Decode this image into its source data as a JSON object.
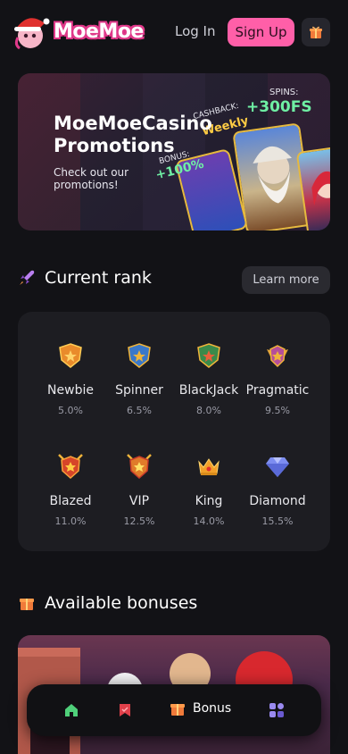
{
  "header": {
    "logo_text": "MoeMoe",
    "login_label": "Log In",
    "signup_label": "Sign Up",
    "gift_icon": "gift-icon"
  },
  "promo": {
    "title": "MoeMoeCasino Promotions",
    "subtitle": "Check out our promotions!",
    "spins_label": "SPINS:",
    "spins_value": "+300FS",
    "cashback_label": "CASHBACK:",
    "cashback_value": "Weekly",
    "bonus_label": "BONUS:",
    "bonus_value": "+100%"
  },
  "rank": {
    "title": "Current rank",
    "learn_more": "Learn more",
    "items": [
      {
        "name": "Newbie",
        "pct": "5.0%",
        "color": "#e98b2b"
      },
      {
        "name": "Spinner",
        "pct": "6.5%",
        "color": "#3a78c9"
      },
      {
        "name": "BlackJack",
        "pct": "8.0%",
        "color": "#3a8a4a"
      },
      {
        "name": "Pragmatic",
        "pct": "9.5%",
        "color": "#b54e9a"
      },
      {
        "name": "Blazed",
        "pct": "11.0%",
        "color": "#d64529"
      },
      {
        "name": "VIP",
        "pct": "12.5%",
        "color": "#e07b2a"
      },
      {
        "name": "King",
        "pct": "14.0%",
        "color": "#f2a02a"
      },
      {
        "name": "Diamond",
        "pct": "15.5%",
        "color": "#7d8df0"
      }
    ]
  },
  "bonuses": {
    "title": "Available bonuses"
  },
  "nav": {
    "bonus_label": "Bonus"
  },
  "colors": {
    "accent_pink": "#ff5fa8",
    "background": "#121216",
    "card": "#1d1d22",
    "green": "#6ff0a4"
  }
}
